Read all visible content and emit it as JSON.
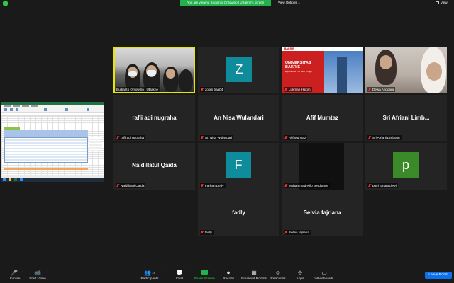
{
  "topbar": {
    "banner": "You are viewing Budianto Ontowirjo | UBakrie's screen",
    "view_options": "View Options",
    "view_options_caret": "⌄",
    "view": "View"
  },
  "tiles": [
    {
      "id": "t1",
      "label": "Budianto Ontowirjo | UBakrie",
      "type": "room",
      "active": true
    },
    {
      "id": "t2",
      "label": "zoom baa04",
      "type": "avatar",
      "initial": "Z",
      "color": "#0e8c9c"
    },
    {
      "id": "t3",
      "label": "Lukman Hakim",
      "type": "slide",
      "slide_logo": "BAKRIE",
      "slide_title": "UNIVERSITAS BAKRIE",
      "slide_sub": "Experience The Best Things"
    },
    {
      "id": "t4",
      "label": "Dewa Anggara",
      "type": "webcam"
    },
    {
      "id": "t5",
      "label": "rafli adi nugraha",
      "name": "rafli adi nugraha"
    },
    {
      "id": "t6",
      "label": "An Nisa Wulandari",
      "name": "An Nisa Wulandari"
    },
    {
      "id": "t7",
      "label": "Afif Mumtaz",
      "name": "Afif Mumtaz"
    },
    {
      "id": "t8",
      "label": "Sri Afriani Limbong",
      "name": "Sri  Afriani  Limb..."
    },
    {
      "id": "t9",
      "label": "Naidillatul Qaida",
      "name": "Naidillatul Qaida"
    },
    {
      "id": "t10",
      "label": "Farhan Dedy",
      "type": "avatar",
      "initial": "F",
      "color": "#0e8c9c"
    },
    {
      "id": "t11",
      "label": "Muhammad Rifo gesdiantie",
      "type": "dark"
    },
    {
      "id": "t12",
      "label": "putri tunggadewi",
      "type": "avatar",
      "initial": "p",
      "color": "#3b8a2a"
    },
    {
      "id": "t13",
      "label": "fadly",
      "name": "fadly"
    },
    {
      "id": "t14",
      "label": "Selvia fajriana",
      "name": "Selvia fajriana"
    }
  ],
  "toolbar": {
    "unmute": "Unmute",
    "start_video": "Start Video",
    "participants": "Participants",
    "participants_count": "14",
    "chat": "Chat",
    "share_screen": "Share Screen",
    "record": "Record",
    "breakout_rooms": "Breakout Rooms",
    "reactions": "Reactions",
    "apps": "Apps",
    "whiteboards": "Whiteboards",
    "leave": "Leave Room",
    "caret": "^"
  },
  "icons": {
    "mic": "🎤",
    "video": "📹",
    "participants": "👥",
    "chat": "💬",
    "record": "⏺",
    "breakout": "▦",
    "reactions": "☺",
    "apps": "⟐",
    "whiteboards": "▭"
  }
}
